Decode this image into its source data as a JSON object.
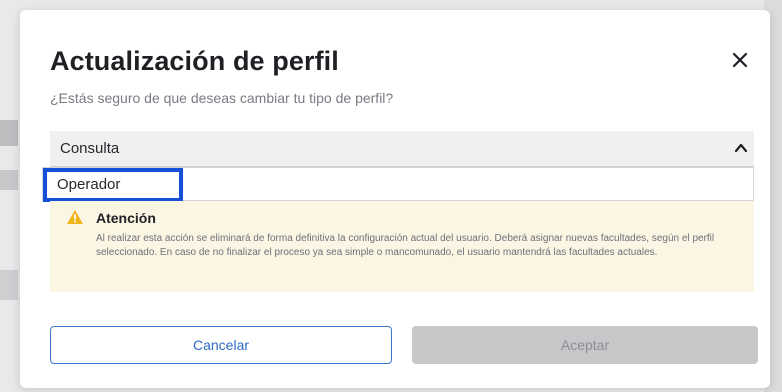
{
  "dialog": {
    "title": "Actualización de perfil",
    "subtitle": "¿Estás seguro de que deseas cambiar tu tipo de perfil?",
    "close_icon": "close-icon"
  },
  "profile_select": {
    "value": "Consulta",
    "chevron_icon": "chevron-up-icon",
    "options": [
      "Operador"
    ]
  },
  "alert": {
    "icon": "warning-icon",
    "title": "Atención",
    "body": "Al realizar esta acción se eliminará de forma definitiva la configuración actual del usuario. Deberá asignar nuevas facultades, según el perfil seleccionado. En caso de no finalizar el proceso ya sea simple o mancomunado, el usuario mantendrá las facultades actuales."
  },
  "buttons": {
    "cancel": "Cancelar",
    "accept": "Aceptar"
  },
  "colors": {
    "highlight": "#1450d8",
    "alert_bg": "#fbf6e4",
    "warning": "#f0b41c",
    "cancel_border": "#3b78c9",
    "accept_disabled": "#c7c7ca"
  }
}
